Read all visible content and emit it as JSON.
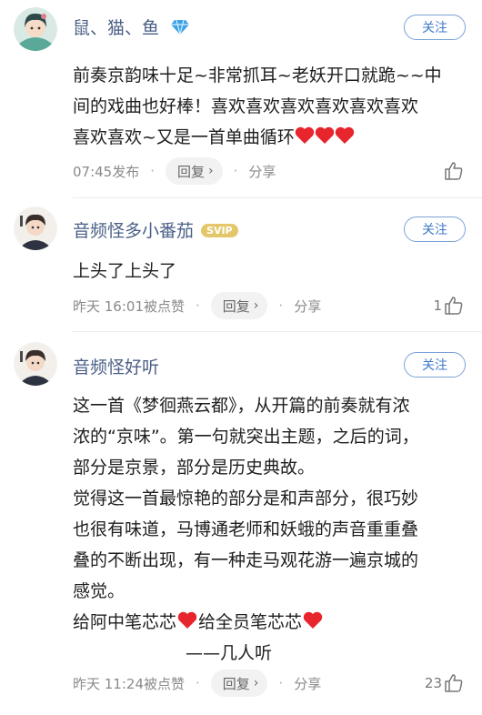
{
  "comments": [
    {
      "username": "鼠、猫、鱼",
      "follow_label": "关注",
      "lines": [
        "前奏京韵味十足~非常抓耳~老妖开口就跪~~中",
        "间的戏曲也好棒！喜欢喜欢喜欢喜欢喜欢喜欢",
        "喜欢喜欢~又是一首单曲循环"
      ],
      "time": "07:45发布",
      "reply_label": "回复",
      "share_label": "分享",
      "likes": ""
    },
    {
      "username": "音频怪多小番茄",
      "badge": "SVIP",
      "follow_label": "关注",
      "lines": [
        "上头了上头了"
      ],
      "time": "昨天 16:01被点赞",
      "reply_label": "回复",
      "share_label": "分享",
      "likes": "1"
    },
    {
      "username": "音频怪好听",
      "follow_label": "关注",
      "lines": [
        "这一首《梦徊燕云都》，从开篇的前奏就有浓",
        "浓的“京味”。第一句就突出主题，之后的词，",
        "部分是京景，部分是历史典故。",
        "觉得这一首最惊艳的部分是和声部分，很巧妙",
        "也很有味道，马博通老师和妖蛾的声音重重叠",
        "叠的不断出现，有一种走马观花游一遍京城的",
        "感觉。",
        "给阿中笔芯芯",
        "给全员笔芯芯",
        "——几人听"
      ],
      "time": "昨天 11:24被点赞",
      "reply_label": "回复",
      "share_label": "分享",
      "likes": "23"
    }
  ],
  "icons": {
    "verified_badge": "diamond-icon",
    "heart": "red-heart-icon",
    "like": "thumbs-up-icon"
  },
  "colors": {
    "username": "#4a5f86",
    "follow": "#3f78c9",
    "heart": "#e8242c",
    "svip": "#e4c76a"
  }
}
